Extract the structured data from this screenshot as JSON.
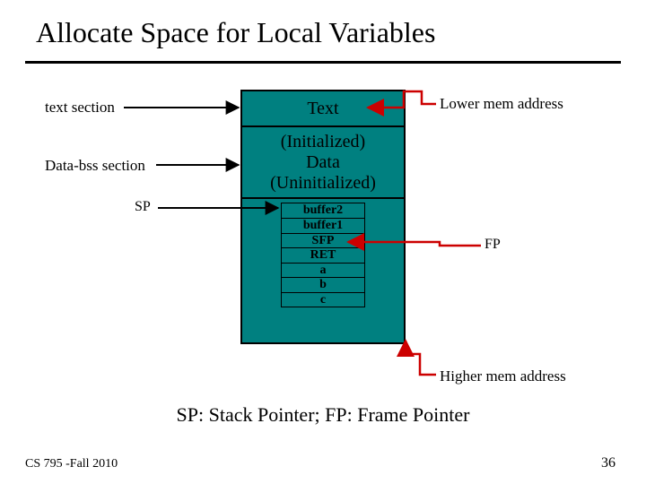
{
  "title": "Allocate Space for Local Variables",
  "labels": {
    "text_section": "text section",
    "data_section": "Data-bss section",
    "sp": "SP",
    "lower": "Lower mem address",
    "higher": "Higher mem address",
    "fp": "FP"
  },
  "segments": {
    "text": "Text",
    "data": "(Initialized)\nData\n(Uninitialized)"
  },
  "stack": {
    "buffer2": "buffer2",
    "buffer1": "buffer1",
    "sfp": "SFP",
    "ret": "RET",
    "a": "a",
    "b": "b",
    "c": "c"
  },
  "caption": "SP: Stack Pointer; FP: Frame Pointer",
  "footer": {
    "course": "CS 795 -Fall 2010",
    "page": "36"
  },
  "colors": {
    "teal": "#008080",
    "red": "#cc0000"
  }
}
